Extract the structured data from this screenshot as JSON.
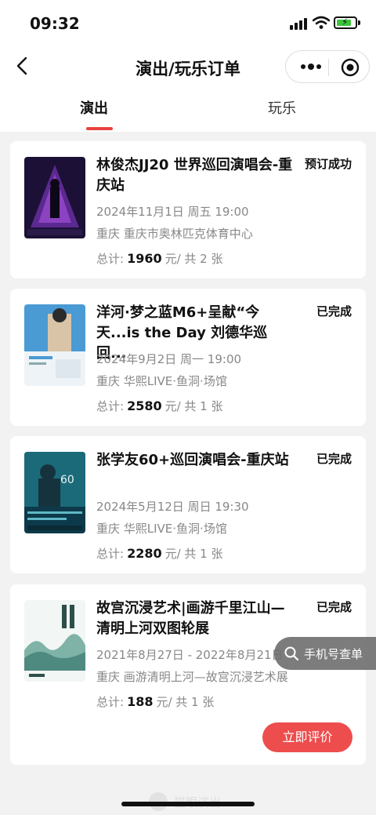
{
  "status_bar": {
    "time": "09:32"
  },
  "nav": {
    "title": "演出/玩乐订单"
  },
  "tabs": [
    {
      "label": "演出",
      "active": true
    },
    {
      "label": "玩乐",
      "active": false
    }
  ],
  "orders": [
    {
      "title": "林俊杰JJ20 世界巡回演唱会-重庆站",
      "status": "预订成功",
      "datetime": "2024年11月1日 周五 19:00",
      "venue": "重庆 重庆市奥林匹克体育中心",
      "total_prefix": "总计:",
      "amount": "1960",
      "total_suffix": "元/ 共 2 张"
    },
    {
      "title": "洋河·梦之蓝M6+呈献“今天...is the Day 刘德华巡回...",
      "status": "已完成",
      "datetime": "2024年9月2日 周一 19:00",
      "venue": "重庆 华熙LIVE·鱼洞·场馆",
      "total_prefix": "总计:",
      "amount": "2580",
      "total_suffix": "元/ 共 1 张"
    },
    {
      "title": "张学友60+巡回演唱会-重庆站",
      "status": "已完成",
      "datetime": "2024年5月12日 周日 19:30",
      "venue": "重庆 华熙LIVE·鱼洞·场馆",
      "total_prefix": "总计:",
      "amount": "2280",
      "total_suffix": "元/ 共 1 张"
    },
    {
      "title": "故宫沉浸艺术|画游千里江山—清明上河双图轮展",
      "status": "已完成",
      "datetime": "2021年8月27日 - 2022年8月21日",
      "venue": "重庆 画游清明上河—故宫沉浸艺术展",
      "total_prefix": "总计:",
      "amount": "188",
      "total_suffix": "元/ 共 1 张",
      "action": "立即评价"
    }
  ],
  "float_button": {
    "label": "手机号查单"
  },
  "brand": {
    "text": "猫眼演出"
  },
  "colors": {
    "accent": "#e8433f",
    "button": "#ee4d4d"
  }
}
